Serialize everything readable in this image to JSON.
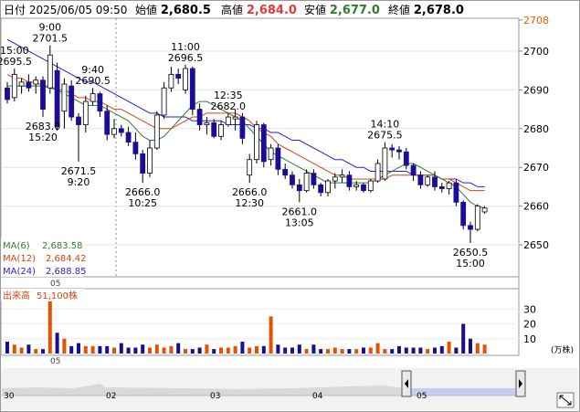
{
  "header": {
    "datetime": "日付 2025/06/05 09:50",
    "open_label": "始値",
    "open": "2,680.5",
    "high_label": "高値",
    "high": "2,684.0",
    "low_label": "安値",
    "low": "2,677.0",
    "close_label": "終値",
    "close": "2,678.0"
  },
  "colors": {
    "up": "#ffffff",
    "down": "#1a0e96",
    "ma6": "#2e7d32",
    "ma12": "#d84315",
    "ma24": "#2a1fd6",
    "vol": "#e65100",
    "high": "#e53935",
    "low": "#2e7d32"
  },
  "ma_legend": [
    {
      "label": "MA(6)",
      "value": "2,683.58"
    },
    {
      "label": "MA(12)",
      "value": "2,684.42"
    },
    {
      "label": "MA(24)",
      "value": "2,688.85"
    }
  ],
  "volume_legend": {
    "label": "出来高",
    "value": "51,100株"
  },
  "volume_unit": "(万株)",
  "day_marker": "05",
  "nav_labels": [
    "30",
    "02",
    "03",
    "04",
    "05"
  ],
  "chart_data": {
    "type": "candlestick",
    "price_axis": {
      "ticks": [
        2650,
        2660,
        2670,
        2680,
        2690,
        2700,
        2708
      ],
      "range": [
        2642,
        2708
      ]
    },
    "volume_axis": {
      "ticks": [
        10,
        20,
        30
      ],
      "range": [
        0,
        40
      ],
      "unit": "万株"
    },
    "candles": [
      {
        "o": 2690.5,
        "h": 2692.0,
        "l": 2686.5,
        "c": 2687.5
      },
      {
        "o": 2688.0,
        "h": 2695.5,
        "l": 2687.0,
        "c": 2694.0
      },
      {
        "o": 2691.0,
        "h": 2693.0,
        "l": 2689.0,
        "c": 2692.0
      },
      {
        "o": 2692.0,
        "h": 2694.0,
        "l": 2689.5,
        "c": 2690.5
      },
      {
        "o": 2691.5,
        "h": 2693.5,
        "l": 2689.0,
        "c": 2692.5
      },
      {
        "o": 2692.5,
        "h": 2693.5,
        "l": 2683.0,
        "c": 2685.0
      },
      {
        "o": 2690.5,
        "h": 2701.5,
        "l": 2689.0,
        "c": 2699.0
      },
      {
        "o": 2695.0,
        "h": 2697.0,
        "l": 2679.5,
        "c": 2680.5
      },
      {
        "o": 2684.5,
        "h": 2693.0,
        "l": 2680.0,
        "c": 2691.5
      },
      {
        "o": 2691.0,
        "h": 2692.5,
        "l": 2682.0,
        "c": 2683.0
      },
      {
        "o": 2683.0,
        "h": 2684.0,
        "l": 2671.5,
        "c": 2681.0
      },
      {
        "o": 2681.0,
        "h": 2688.5,
        "l": 2679.0,
        "c": 2687.0
      },
      {
        "o": 2687.0,
        "h": 2690.5,
        "l": 2686.0,
        "c": 2689.0
      },
      {
        "o": 2689.0,
        "h": 2689.5,
        "l": 2683.0,
        "c": 2684.5
      },
      {
        "o": 2684.5,
        "h": 2686.0,
        "l": 2677.0,
        "c": 2678.5
      },
      {
        "o": 2678.5,
        "h": 2682.5,
        "l": 2677.5,
        "c": 2680.0
      },
      {
        "o": 2680.0,
        "h": 2681.0,
        "l": 2678.0,
        "c": 2679.0
      },
      {
        "o": 2679.0,
        "h": 2680.5,
        "l": 2675.5,
        "c": 2676.5
      },
      {
        "o": 2676.5,
        "h": 2679.0,
        "l": 2672.0,
        "c": 2673.5
      },
      {
        "o": 2673.5,
        "h": 2674.5,
        "l": 2666.0,
        "c": 2668.5
      },
      {
        "o": 2668.5,
        "h": 2677.0,
        "l": 2667.5,
        "c": 2675.0
      },
      {
        "o": 2675.0,
        "h": 2684.5,
        "l": 2674.5,
        "c": 2683.5
      },
      {
        "o": 2683.5,
        "h": 2692.0,
        "l": 2682.5,
        "c": 2690.5
      },
      {
        "o": 2690.5,
        "h": 2696.0,
        "l": 2689.5,
        "c": 2694.0
      },
      {
        "o": 2694.0,
        "h": 2695.5,
        "l": 2691.5,
        "c": 2693.0
      },
      {
        "o": 2690.0,
        "h": 2696.5,
        "l": 2689.0,
        "c": 2695.5
      },
      {
        "o": 2695.5,
        "h": 2696.0,
        "l": 2683.5,
        "c": 2685.0
      },
      {
        "o": 2685.0,
        "h": 2686.5,
        "l": 2679.5,
        "c": 2681.0
      },
      {
        "o": 2681.0,
        "h": 2683.0,
        "l": 2678.5,
        "c": 2681.5
      },
      {
        "o": 2681.5,
        "h": 2682.5,
        "l": 2677.5,
        "c": 2678.0
      },
      {
        "o": 2678.0,
        "h": 2682.0,
        "l": 2677.0,
        "c": 2681.0
      },
      {
        "o": 2681.0,
        "h": 2684.0,
        "l": 2680.5,
        "c": 2683.0
      },
      {
        "o": 2682.5,
        "h": 2685.0,
        "l": 2679.5,
        "c": 2683.0
      },
      {
        "o": 2683.0,
        "h": 2684.0,
        "l": 2676.0,
        "c": 2677.5
      },
      {
        "o": 2668.0,
        "h": 2673.5,
        "l": 2666.0,
        "c": 2672.0
      },
      {
        "o": 2672.0,
        "h": 2682.0,
        "l": 2671.0,
        "c": 2681.0
      },
      {
        "o": 2681.0,
        "h": 2681.5,
        "l": 2670.0,
        "c": 2671.5
      },
      {
        "o": 2672.0,
        "h": 2676.0,
        "l": 2670.5,
        "c": 2675.0
      },
      {
        "o": 2675.0,
        "h": 2676.0,
        "l": 2668.0,
        "c": 2669.5
      },
      {
        "o": 2669.5,
        "h": 2671.0,
        "l": 2667.0,
        "c": 2668.0
      },
      {
        "o": 2668.0,
        "h": 2669.0,
        "l": 2664.5,
        "c": 2665.5
      },
      {
        "o": 2665.5,
        "h": 2667.0,
        "l": 2661.0,
        "c": 2664.0
      },
      {
        "o": 2664.0,
        "h": 2669.5,
        "l": 2663.5,
        "c": 2668.5
      },
      {
        "o": 2668.5,
        "h": 2669.5,
        "l": 2664.5,
        "c": 2665.5
      },
      {
        "o": 2665.5,
        "h": 2666.0,
        "l": 2662.5,
        "c": 2663.5
      },
      {
        "o": 2663.5,
        "h": 2667.0,
        "l": 2662.5,
        "c": 2666.5
      },
      {
        "o": 2666.5,
        "h": 2668.5,
        "l": 2664.5,
        "c": 2667.5
      },
      {
        "o": 2667.5,
        "h": 2669.5,
        "l": 2666.0,
        "c": 2668.0
      },
      {
        "o": 2668.0,
        "h": 2669.0,
        "l": 2664.0,
        "c": 2665.0
      },
      {
        "o": 2665.0,
        "h": 2666.5,
        "l": 2664.0,
        "c": 2665.5
      },
      {
        "o": 2665.5,
        "h": 2666.0,
        "l": 2663.5,
        "c": 2664.0
      },
      {
        "o": 2664.0,
        "h": 2667.0,
        "l": 2663.5,
        "c": 2666.5
      },
      {
        "o": 2666.5,
        "h": 2672.0,
        "l": 2666.0,
        "c": 2671.0
      },
      {
        "o": 2667.0,
        "h": 2676.5,
        "l": 2666.5,
        "c": 2675.0
      },
      {
        "o": 2675.0,
        "h": 2676.0,
        "l": 2672.5,
        "c": 2674.5
      },
      {
        "o": 2674.5,
        "h": 2675.5,
        "l": 2672.0,
        "c": 2674.0
      },
      {
        "o": 2674.0,
        "h": 2675.0,
        "l": 2669.5,
        "c": 2670.5
      },
      {
        "o": 2670.5,
        "h": 2671.0,
        "l": 2666.5,
        "c": 2668.0
      },
      {
        "o": 2668.0,
        "h": 2669.0,
        "l": 2664.5,
        "c": 2665.5
      },
      {
        "o": 2665.5,
        "h": 2668.0,
        "l": 2665.0,
        "c": 2667.5
      },
      {
        "o": 2667.5,
        "h": 2669.0,
        "l": 2664.0,
        "c": 2665.0
      },
      {
        "o": 2665.0,
        "h": 2666.0,
        "l": 2663.5,
        "c": 2664.5
      },
      {
        "o": 2664.5,
        "h": 2666.5,
        "l": 2663.0,
        "c": 2666.0
      },
      {
        "o": 2666.0,
        "h": 2667.0,
        "l": 2660.0,
        "c": 2661.0
      },
      {
        "o": 2661.0,
        "h": 2661.5,
        "l": 2654.0,
        "c": 2655.0
      },
      {
        "o": 2655.0,
        "h": 2656.0,
        "l": 2650.5,
        "c": 2654.0
      },
      {
        "o": 2654.0,
        "h": 2660.5,
        "l": 2653.5,
        "c": 2660.0
      },
      {
        "o": 2658.5,
        "h": 2660.0,
        "l": 2658.0,
        "c": 2659.5
      }
    ],
    "volumes": [
      8,
      6,
      4,
      6,
      3,
      3,
      40,
      14,
      10,
      5,
      7,
      5,
      5,
      5,
      5,
      4,
      7,
      4,
      4,
      6,
      4,
      6,
      4,
      5,
      7,
      3,
      3,
      4,
      6,
      3,
      4,
      4,
      5,
      8,
      4,
      5,
      5,
      25,
      6,
      4,
      4,
      6,
      3,
      6,
      3,
      3,
      4,
      3,
      3,
      3,
      4,
      4,
      7,
      3,
      3,
      5,
      4,
      4,
      4,
      3,
      4,
      5,
      8,
      4,
      20,
      10,
      7,
      6
    ],
    "ma6": [
      2691,
      2691,
      2691,
      2691,
      2691,
      2691,
      2690.5,
      2690,
      2689,
      2688,
      2687,
      2686,
      2686,
      2686,
      2685,
      2684,
      2683,
      2682,
      2680,
      2678,
      2677,
      2677,
      2678,
      2680,
      2682,
      2684,
      2686,
      2687,
      2687,
      2686,
      2685,
      2684,
      2683,
      2682,
      2680,
      2678,
      2676,
      2674,
      2673,
      2672,
      2671,
      2670,
      2669,
      2668,
      2667,
      2666,
      2666,
      2666,
      2666,
      2666,
      2666,
      2666,
      2667,
      2668,
      2669,
      2670,
      2671,
      2671,
      2670,
      2669,
      2668,
      2667,
      2666,
      2665,
      2663,
      2661,
      2660,
      2659.5
    ],
    "ma12": [
      2694,
      2693,
      2693,
      2692,
      2692,
      2691,
      2691,
      2690,
      2690,
      2689,
      2688,
      2688,
      2687,
      2687,
      2686,
      2685,
      2685,
      2684,
      2683,
      2682,
      2681,
      2680,
      2680,
      2680,
      2681,
      2682,
      2683,
      2683,
      2684,
      2684,
      2684,
      2684,
      2684,
      2683,
      2682,
      2680,
      2679,
      2678,
      2676,
      2675,
      2674,
      2673,
      2672,
      2671,
      2670,
      2669,
      2668,
      2668,
      2667,
      2667,
      2667,
      2667,
      2667,
      2667,
      2668,
      2668,
      2668,
      2668,
      2668,
      2668,
      2668,
      2667,
      2667,
      2666,
      2665,
      2664,
      2664,
      2664
    ],
    "ma24": [
      2703,
      2702,
      2701,
      2700,
      2699,
      2698,
      2697,
      2696,
      2695,
      2694,
      2693,
      2692,
      2692,
      2691,
      2690,
      2689,
      2688,
      2687,
      2686,
      2685,
      2684,
      2684,
      2683,
      2683,
      2683,
      2683,
      2682,
      2682,
      2682,
      2682,
      2682,
      2681,
      2681,
      2681,
      2681,
      2680,
      2680,
      2679,
      2679,
      2678,
      2677,
      2677,
      2676,
      2675,
      2674,
      2673,
      2672,
      2672,
      2671,
      2670,
      2670,
      2669,
      2669,
      2669,
      2669,
      2669,
      2669,
      2668,
      2668,
      2668,
      2668,
      2667,
      2667,
      2667,
      2666,
      2666,
      2665,
      2665
    ],
    "annotations": [
      {
        "i": 1,
        "price": "2695.5",
        "time": "15:00",
        "pos": "above"
      },
      {
        "i": 5,
        "price": "2683.0",
        "time": "15:20",
        "pos": "below"
      },
      {
        "i": 6,
        "price": "2701.5",
        "time": "9:00",
        "pos": "above"
      },
      {
        "i": 10,
        "price": "2671.5",
        "time": "9:20",
        "pos": "below"
      },
      {
        "i": 12,
        "price": "2690.5",
        "time": "9:40",
        "pos": "above"
      },
      {
        "i": 19,
        "price": "2666.0",
        "time": "10:25",
        "pos": "below"
      },
      {
        "i": 25,
        "price": "2696.5",
        "time": "11:00",
        "pos": "above"
      },
      {
        "i": 31,
        "price": "2682.0",
        "time": "12:35",
        "pos": "above"
      },
      {
        "i": 34,
        "price": "2666.0",
        "time": "12:30",
        "pos": "below"
      },
      {
        "i": 41,
        "price": "2661.0",
        "time": "13:05",
        "pos": "below"
      },
      {
        "i": 53,
        "price": "2675.5",
        "time": "14:10",
        "pos": "above"
      },
      {
        "i": 65,
        "price": "2650.5",
        "time": "15:00",
        "pos": "below"
      }
    ]
  }
}
